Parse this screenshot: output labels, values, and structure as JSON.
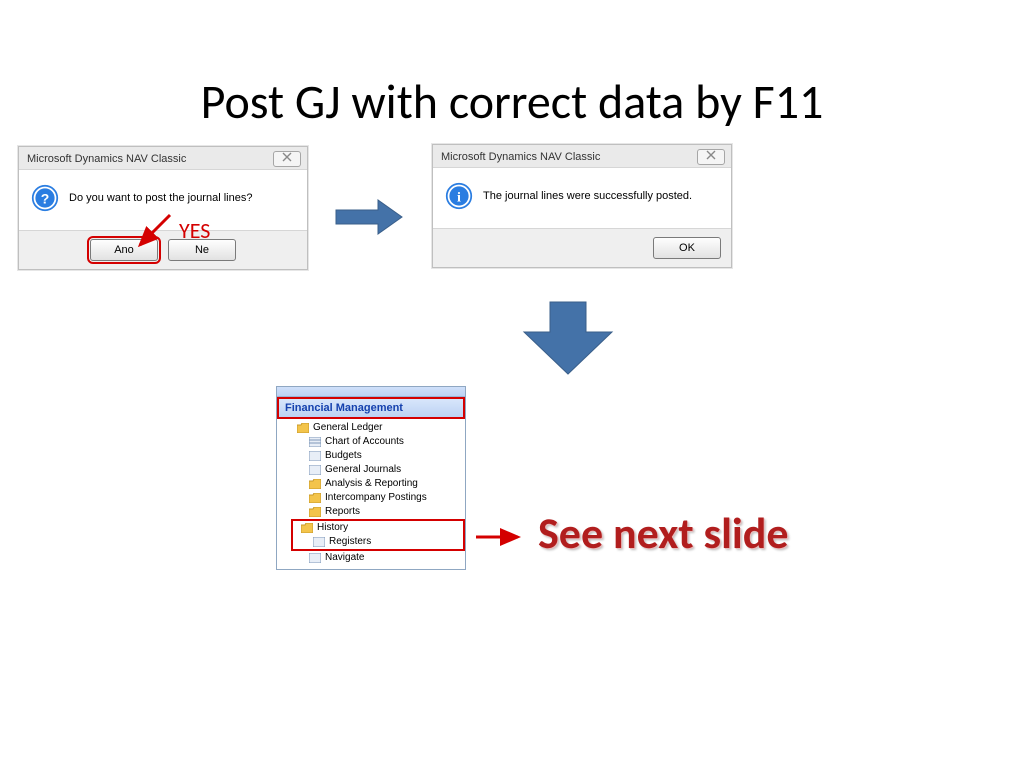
{
  "slide": {
    "title": "Post GJ with correct data by F11",
    "seeNext": "See next slide",
    "yesAnn": "YES"
  },
  "dialog1": {
    "title": "Microsoft Dynamics NAV Classic",
    "close": "✕",
    "message": "Do you want to post the journal lines?",
    "yes": "Ano",
    "no": "Ne"
  },
  "dialog2": {
    "title": "Microsoft Dynamics NAV Classic",
    "close": "✕",
    "message": "The journal lines were successfully posted.",
    "ok": "OK"
  },
  "nav": {
    "header": "Financial Management",
    "items": [
      "General Ledger",
      "Chart of Accounts",
      "Budgets",
      "General Journals",
      "Analysis & Reporting",
      "Intercompany Postings",
      "Reports",
      "History",
      "Registers",
      "Navigate"
    ]
  }
}
